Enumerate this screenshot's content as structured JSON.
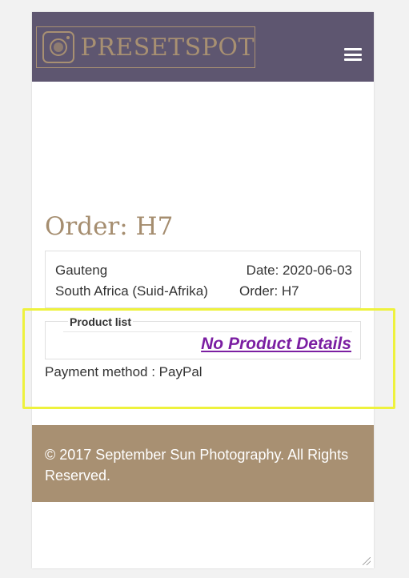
{
  "header": {
    "logo_text": "PRESETSPOT",
    "logo_icon": "camera-icon",
    "menu_icon": "hamburger-menu-icon",
    "background_color": "#5e5670",
    "accent_color": "#a89072"
  },
  "order": {
    "title": "Order: H7",
    "address_line1": "Gauteng",
    "address_line2": "South Africa (Suid-Afrika)",
    "date": "Date: 2020-06-03",
    "order_label": "Order: H7"
  },
  "products": {
    "legend": "Product list",
    "empty_message": "No Product Details"
  },
  "payment": {
    "text": "Payment method : PayPal"
  },
  "footer": {
    "text": "© 2017 September Sun Photography. All Rights Reserved.",
    "background_color": "#a89072"
  },
  "highlight_color": "#eef23d"
}
